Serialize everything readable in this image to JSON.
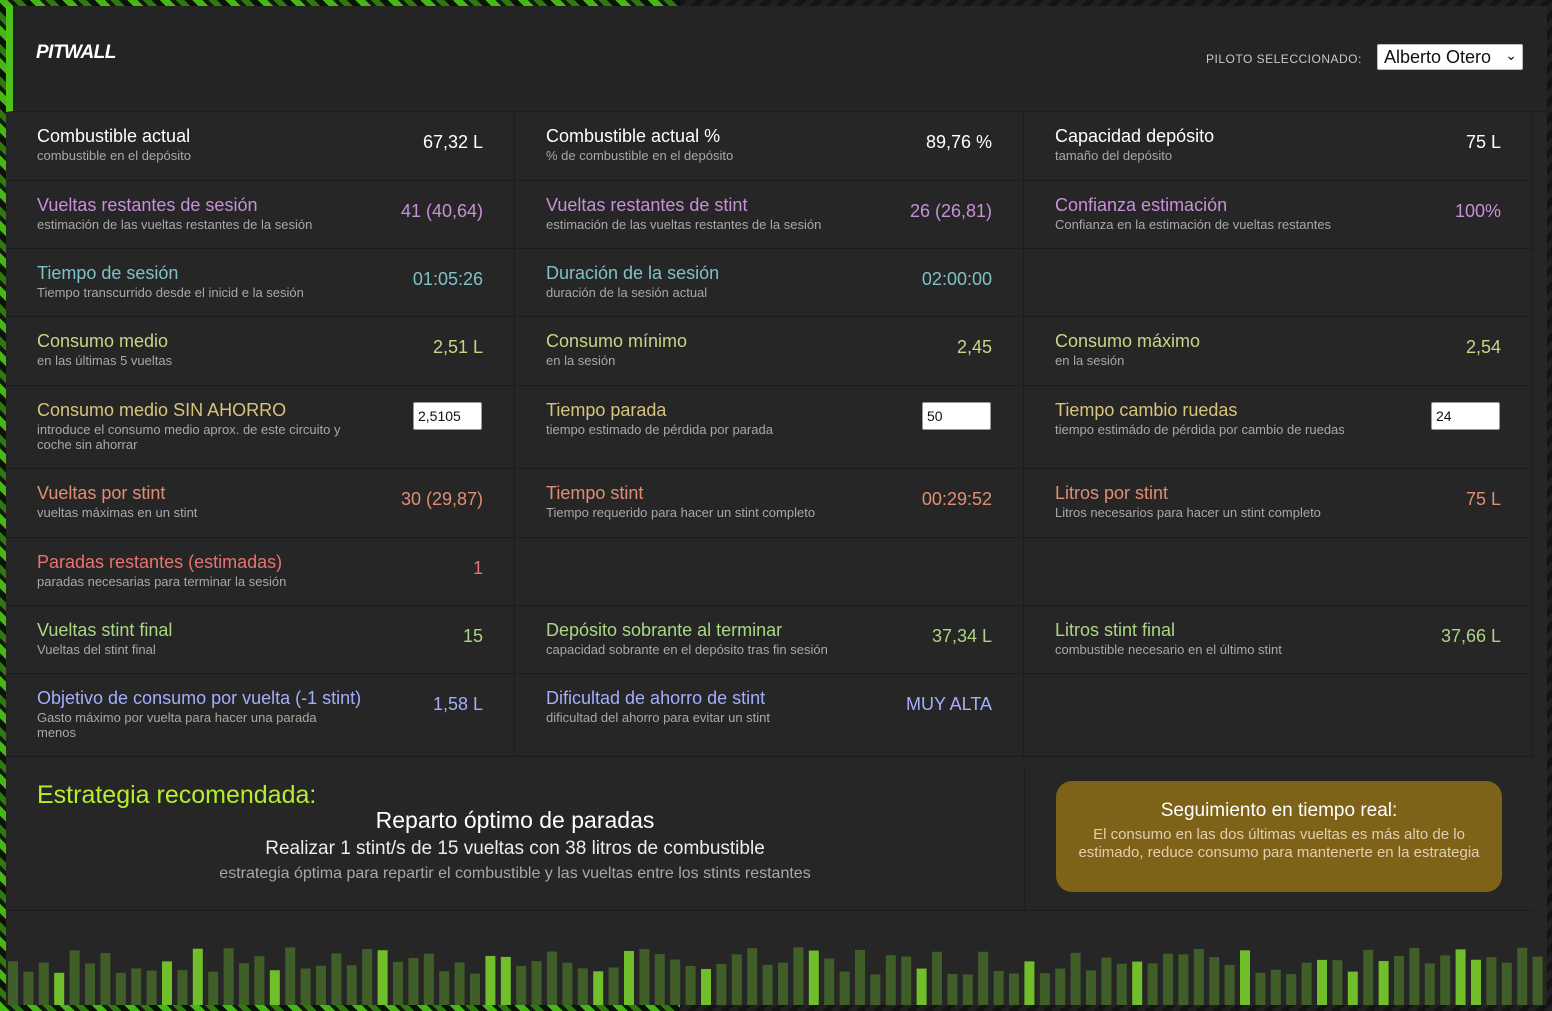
{
  "app": {
    "title": "PITWALL"
  },
  "pilot": {
    "label": "PILOTO SELECCIONADO:",
    "selected": "Alberto Otero"
  },
  "rows": [
    [
      {
        "label": "Combustible actual",
        "sub": "combustible en el depósito",
        "value": "67,32 L",
        "color": "white"
      },
      {
        "label": "Combustible actual %",
        "sub": "% de combustible en el depósito",
        "value": "89,76 %",
        "color": "white"
      },
      {
        "label": "Capacidad depósito",
        "sub": "tamaño del depósito",
        "value": "75 L",
        "color": "white"
      }
    ],
    [
      {
        "label": "Vueltas restantes de sesión",
        "sub": "estimación de las vueltas restantes de la sesión",
        "value": "41 (40,64)",
        "color": "purple"
      },
      {
        "label": "Vueltas restantes de stint",
        "sub": "estimación de las vueltas restantes de la sesión",
        "value": "26 (26,81)",
        "color": "purple"
      },
      {
        "label": "Confianza estimación",
        "sub": "Confianza en la estimación de vueltas restantes",
        "value": "100%",
        "color": "purple"
      }
    ],
    [
      {
        "label": "Tiempo de sesión",
        "sub": "Tiempo transcurrido desde el inicid e la sesión",
        "value": "01:05:26",
        "color": "teal"
      },
      {
        "label": "Duración de la sesión",
        "sub": "duración de la sesión actual",
        "value": "02:00:00",
        "color": "teal"
      },
      null
    ],
    [
      {
        "label": "Consumo medio",
        "sub": "en las últimas 5 vueltas",
        "value": "2,51 L",
        "color": "olive"
      },
      {
        "label": "Consumo mínimo",
        "sub": "en la sesión",
        "value": "2,45",
        "color": "olive"
      },
      {
        "label": "Consumo máximo",
        "sub": "en la sesión",
        "value": "2,54",
        "color": "olive"
      }
    ],
    [
      {
        "label": "Consumo medio SIN AHORRO",
        "sub": "introduce el consumo medio aprox. de este circuito y coche sin ahorrar",
        "input": "2,5105",
        "color": "sand"
      },
      {
        "label": "Tiempo parada",
        "sub": "tiempo estimado de pérdida por parada",
        "input": "50",
        "color": "sand"
      },
      {
        "label": "Tiempo cambio ruedas",
        "sub": "tiempo estimádo de pérdida por cambio de ruedas",
        "input": "24",
        "color": "sand"
      }
    ],
    [
      {
        "label": "Vueltas por stint",
        "sub": "vueltas máximas en un stint",
        "value": "30 (29,87)",
        "color": "salmon"
      },
      {
        "label": "Tiempo stint",
        "sub": "Tiempo requerido para hacer un stint completo",
        "value": "00:29:52",
        "color": "salmon"
      },
      {
        "label": "Litros por stint",
        "sub": "Litros necesarios para hacer un stint completo",
        "value": "75 L",
        "color": "salmon"
      }
    ],
    [
      {
        "label": "Paradas restantes (estimadas)",
        "sub": "paradas necesarias para terminar la sesión",
        "value": "1",
        "color": "red"
      },
      null,
      null
    ],
    [
      {
        "label": "Vueltas stint final",
        "sub": "Vueltas del stint final",
        "value": "15",
        "color": "green"
      },
      {
        "label": "Depósito sobrante al terminar",
        "sub": "capacidad sobrante en el depósito tras fin sesión",
        "value": "37,34 L",
        "color": "green"
      },
      {
        "label": "Litros stint final",
        "sub": "combustible necesario en el último stint",
        "value": "37,66 L",
        "color": "green"
      }
    ],
    [
      {
        "label": "Objetivo de consumo por vuelta (-1 stint)",
        "sub": "Gasto máximo por vuelta para hacer una parada menos",
        "value": "1,58 L",
        "color": "blue"
      },
      {
        "label": "Dificultad de ahorro de stint",
        "sub": "dificultad del ahorro para evitar un stint",
        "value": "MUY ALTA",
        "color": "blue"
      },
      null
    ]
  ],
  "strategy": {
    "title": "Estrategia recomendada:",
    "optimal": "Reparto óptimo de paradas",
    "detail": "Realizar 1 stint/s de 15 vueltas con 38 litros de combustible",
    "note": "estrategia óptima para repartir el combustible y las vueltas entre los stints restantes"
  },
  "realtime": {
    "title": "Seguimiento en tiempo real:",
    "text": "El consumo en las dos últimas vueltas es más alto de lo estimado, reduce consumo para mantenerte en la estrategia",
    "color": "#7d6218"
  },
  "colors": {
    "accent": "#4ec21a",
    "strategy_title": "#b6ee2e",
    "panel": "#262626"
  }
}
